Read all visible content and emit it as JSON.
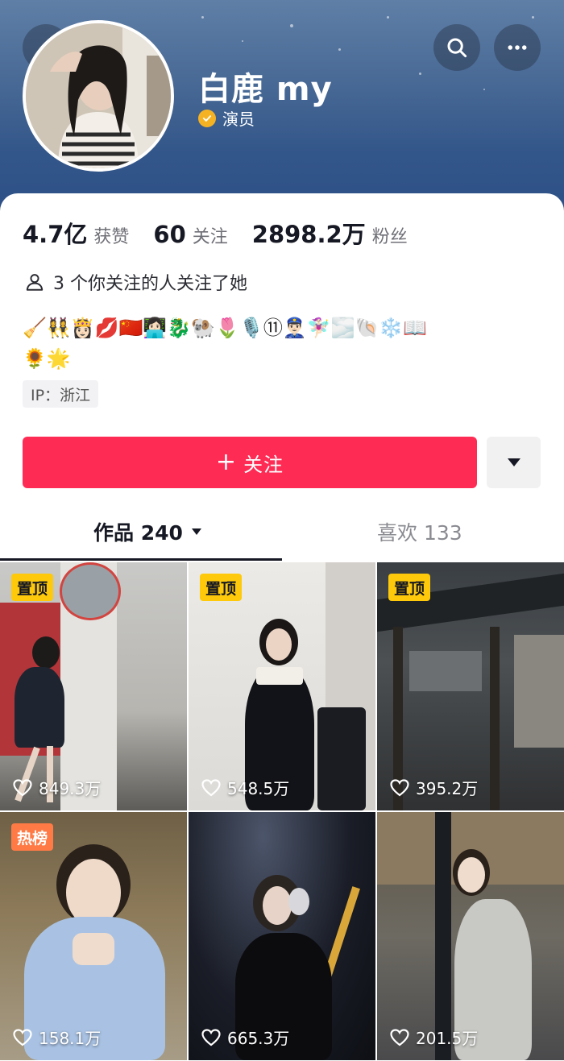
{
  "profile": {
    "name": "白鹿 my",
    "verification": "演员",
    "stats": [
      {
        "value": "4.7亿",
        "label": "获赞"
      },
      {
        "value": "60",
        "label": "关注"
      },
      {
        "value": "2898.2万",
        "label": "粉丝"
      }
    ],
    "mutual_follow_text": "3 个你关注的人关注了她",
    "bio_emoji_line1": "🧹👯‍♀️👸🏻💋🇨🇳👩🏻‍💻🐉🐏🌷🎙️⑪👮🏻‍♂️🧚🏻‍♀️🌫️🐚❄️📖",
    "bio_emoji_line2": "🌻🌟",
    "ip_label": "IP：浙江"
  },
  "actions": {
    "follow_label": "关注",
    "follow_plus": "+"
  },
  "tabs": {
    "works_label": "作品 240",
    "likes_label": "喜欢 133"
  },
  "videos": [
    {
      "badge": "置顶",
      "likes": "849.3万"
    },
    {
      "badge": "置顶",
      "likes": "548.5万"
    },
    {
      "badge": "置顶",
      "likes": "395.2万"
    },
    {
      "badge": "热榜",
      "likes": "158.1万"
    },
    {
      "badge": "",
      "likes": "665.3万"
    },
    {
      "badge": "",
      "likes": "201.5万"
    }
  ],
  "colors": {
    "primary": "#fe2c55",
    "pin_badge": "#fdc90a",
    "hot_badge": "#ff7a45",
    "verified": "#f5b324"
  },
  "icons": [
    "back-arrow-icon",
    "search-icon",
    "more-icon",
    "verified-icon",
    "person-icon",
    "chevron-down-icon",
    "heart-icon"
  ]
}
